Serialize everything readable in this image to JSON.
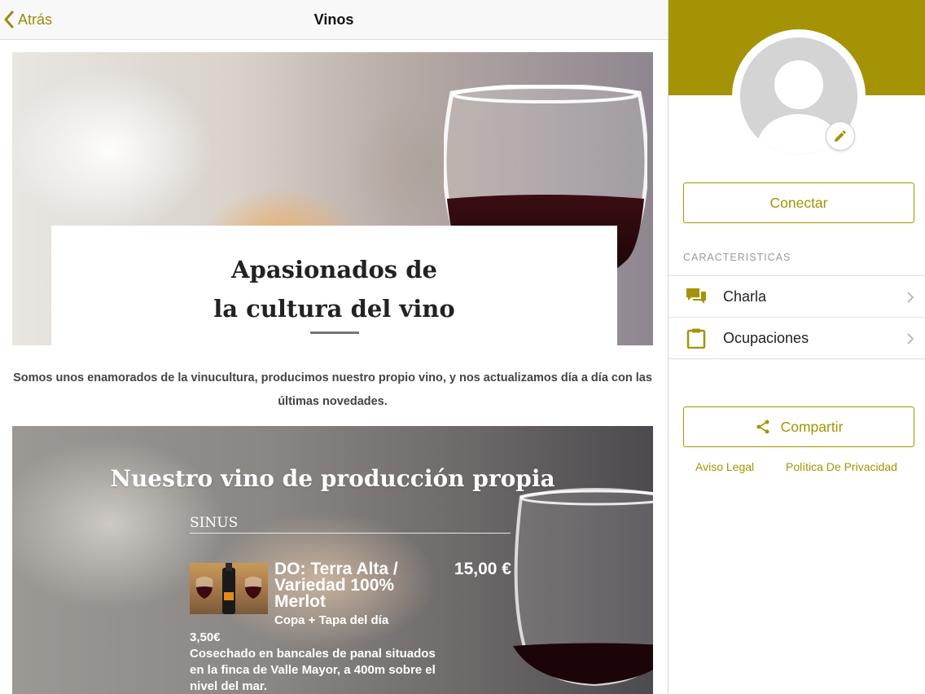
{
  "nav": {
    "back_label": "Atrás",
    "title": "Vinos"
  },
  "hero": {
    "title_line1": "Apasionados de",
    "title_line2": "la cultura del vino"
  },
  "intro": {
    "text": "Somos unos enamorados de la vinucultura, producimos nuestro propio vino, y nos actualizamos día a día con las últimas novedades."
  },
  "wine_section": {
    "title": "Nuestro vino de producción propia",
    "category": "SINUS",
    "item": {
      "name": "DO: Terra Alta / Variedad 100% Merlot",
      "price": "15,00 €",
      "subtitle": "Copa + Tapa del día",
      "description": "3,50€\nCosechado en bancales de panal situados en la finca de Valle Mayor, a 400m sobre el nivel del mar."
    }
  },
  "sidebar": {
    "connect_label": "Conectar",
    "features_header": "CARACTERISTICAS",
    "features": [
      {
        "label": "Charla",
        "icon": "chat-bubbles-icon"
      },
      {
        "label": "Ocupaciones",
        "icon": "clipboard-icon"
      }
    ],
    "share_label": "Compartir",
    "legal_link": "Aviso Legal",
    "privacy_link": "Política De Privacidad"
  },
  "colors": {
    "accent": "#a49304",
    "nav_bg": "#f8f8f8",
    "text": "#222222"
  }
}
